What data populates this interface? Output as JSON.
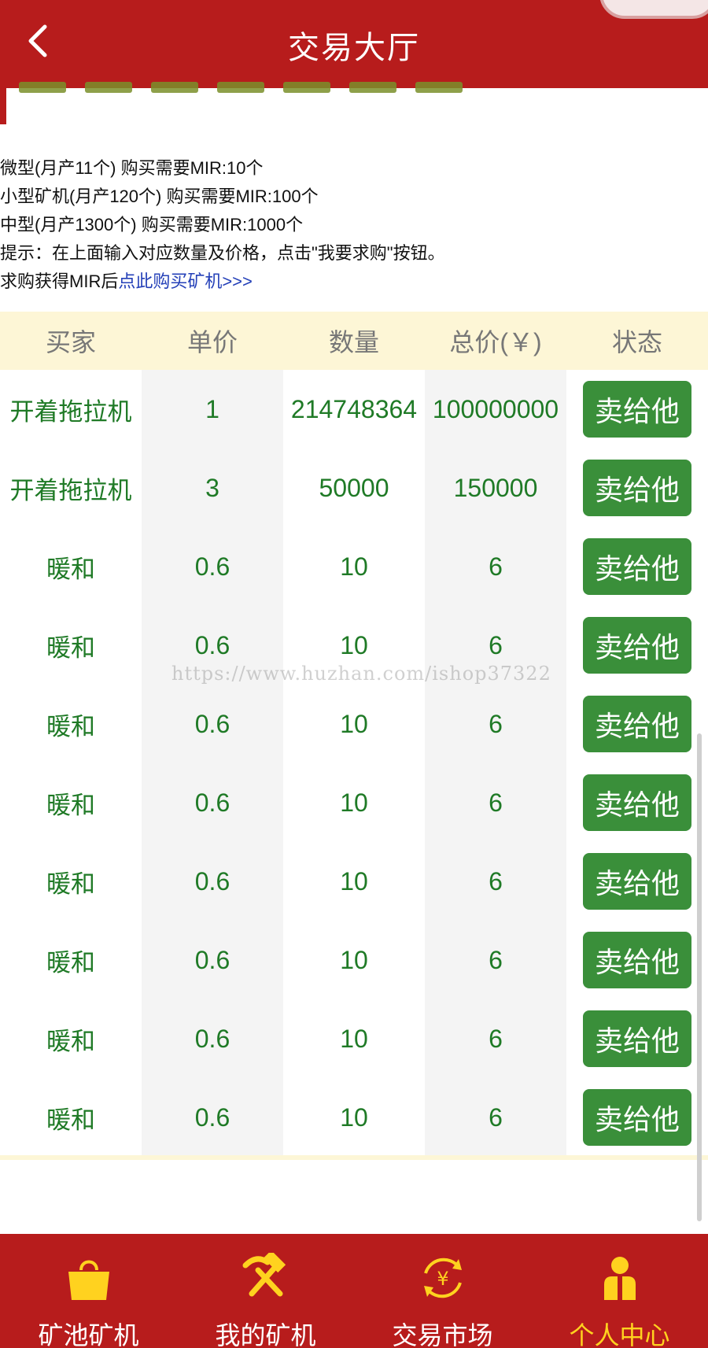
{
  "header": {
    "title": "交易大厅"
  },
  "info": {
    "lines": [
      "微型(月产11个) 购买需要MIR:10个",
      "小型矿机(月产120个) 购买需要MIR:100个",
      "中型(月产1300个) 购买需要MIR:1000个",
      "提示：在上面输入对应数量及价格，点击\"我要求购\"按钮。"
    ],
    "buy_prefix": "求购获得MIR后",
    "buy_link": "点此购买矿机>>>"
  },
  "table": {
    "headers": [
      "买家",
      "单价",
      "数量",
      "总价(￥)",
      "状态"
    ],
    "action_label": "卖给他",
    "rows": [
      {
        "buyer": "开着拖拉机",
        "price": "1",
        "qty": "214748364",
        "total": "100000000"
      },
      {
        "buyer": "开着拖拉机",
        "price": "3",
        "qty": "50000",
        "total": "150000"
      },
      {
        "buyer": "暖和",
        "price": "0.6",
        "qty": "10",
        "total": "6"
      },
      {
        "buyer": "暖和",
        "price": "0.6",
        "qty": "10",
        "total": "6"
      },
      {
        "buyer": "暖和",
        "price": "0.6",
        "qty": "10",
        "total": "6"
      },
      {
        "buyer": "暖和",
        "price": "0.6",
        "qty": "10",
        "total": "6"
      },
      {
        "buyer": "暖和",
        "price": "0.6",
        "qty": "10",
        "total": "6"
      },
      {
        "buyer": "暖和",
        "price": "0.6",
        "qty": "10",
        "total": "6"
      },
      {
        "buyer": "暖和",
        "price": "0.6",
        "qty": "10",
        "total": "6"
      },
      {
        "buyer": "暖和",
        "price": "0.6",
        "qty": "10",
        "total": "6"
      }
    ]
  },
  "watermark": "https://www.huzhan.com/ishop37322",
  "tabs": [
    {
      "label": "矿池矿机",
      "icon": "shopping-bag-icon",
      "active": false
    },
    {
      "label": "我的矿机",
      "icon": "hammer-pickaxe-icon",
      "active": false
    },
    {
      "label": "交易市场",
      "icon": "yuan-exchange-icon",
      "active": false
    },
    {
      "label": "个人中心",
      "icon": "person-icon",
      "active": true
    }
  ],
  "colors": {
    "brand_red": "#b71c1c",
    "green_text": "#1f7a26",
    "button_green": "#3a8f3a",
    "header_row_bg": "#fdf6d6",
    "active_tab": "#ffd21f",
    "icon_yellow": "#ffd21f"
  }
}
